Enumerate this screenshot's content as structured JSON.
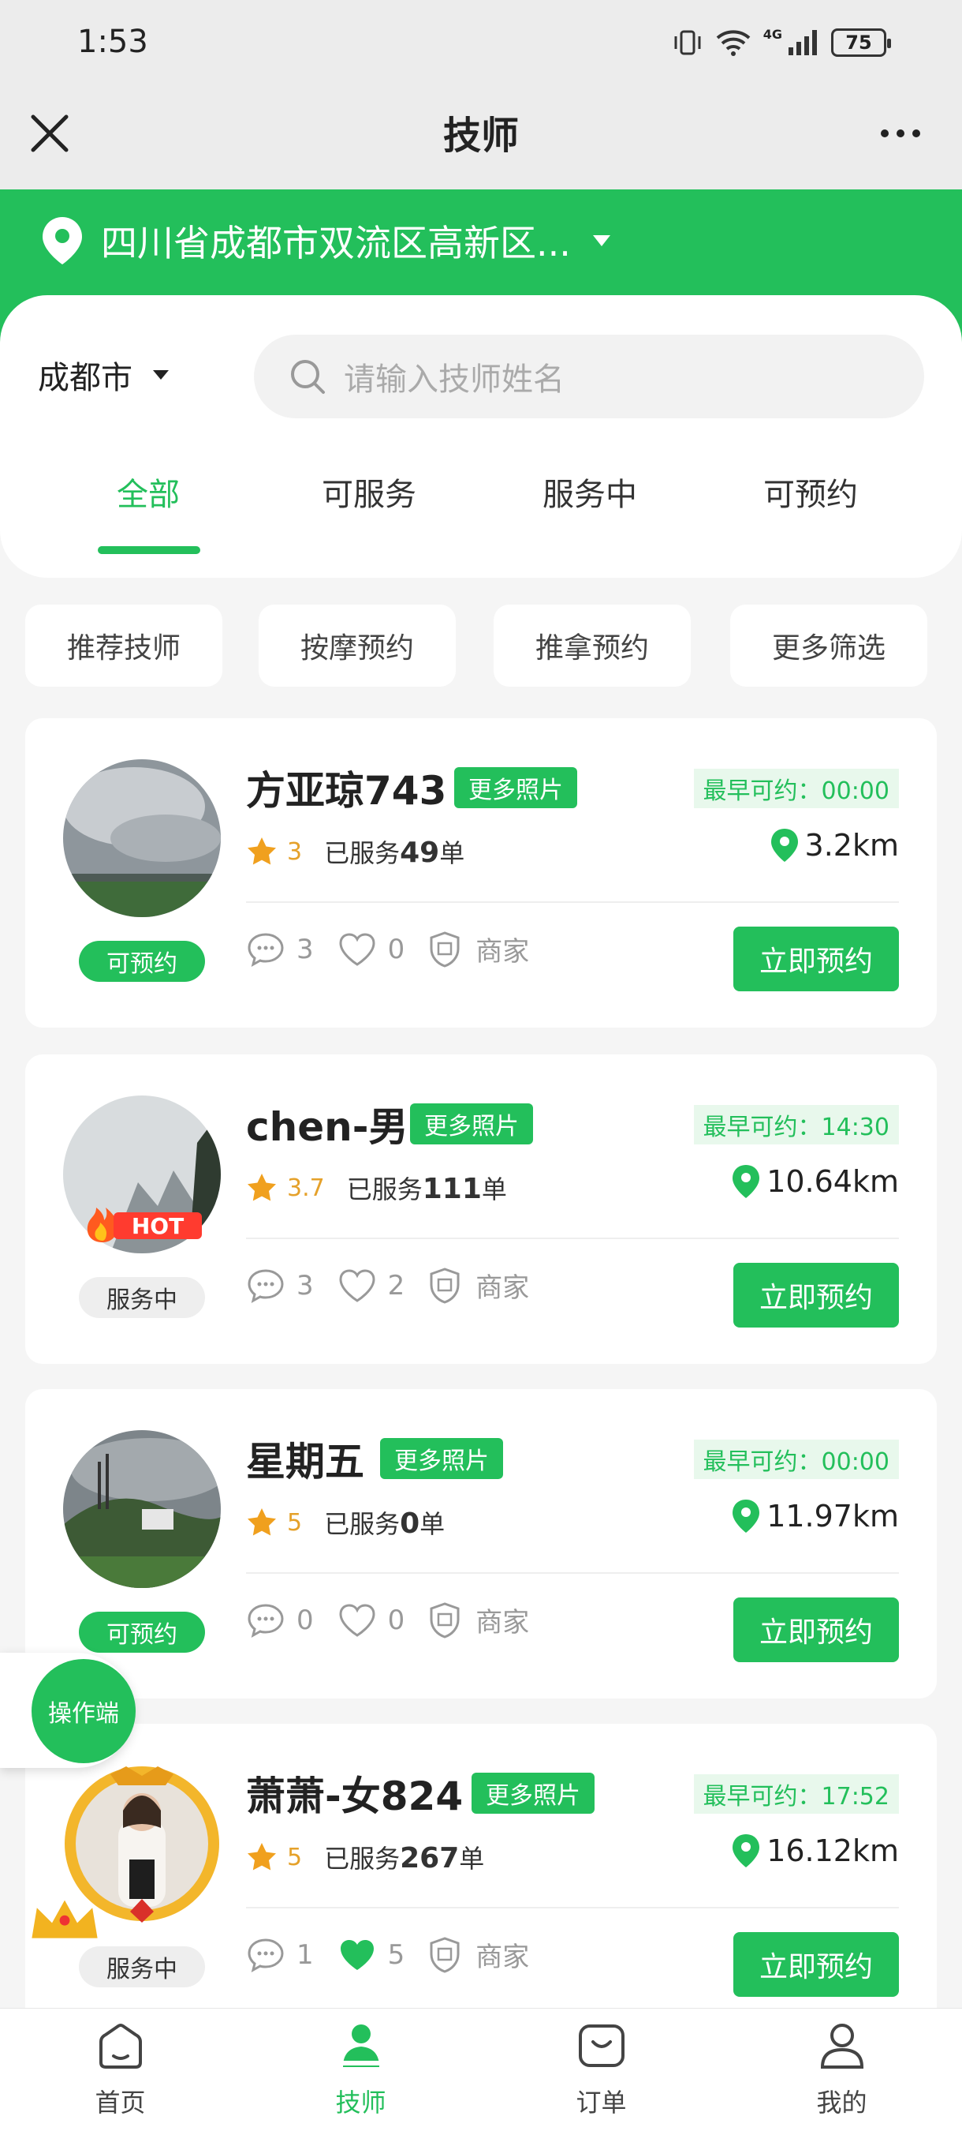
{
  "status_bar": {
    "time": "1:53",
    "battery": "75",
    "network": "4G"
  },
  "header": {
    "title": "技师"
  },
  "location": {
    "text": "四川省成都市双流区高新区..."
  },
  "city": "成都市",
  "search": {
    "placeholder": "请输入技师姓名"
  },
  "tabs": [
    "全部",
    "可服务",
    "服务中",
    "可预约"
  ],
  "filters": [
    "推荐技师",
    "按摩预约",
    "推拿预约",
    "更多筛选"
  ],
  "technicians": [
    {
      "name": "方亚琼743",
      "more_photos": "更多照片",
      "earliest": "最早可约：00:00",
      "rating": "3",
      "served_prefix": "已服务",
      "served_count": "49",
      "served_suffix": "单",
      "distance": "3.2km",
      "comments": "3",
      "likes": "0",
      "shop_label": "商家",
      "status": "可预约",
      "book": "立即预约",
      "hot": false
    },
    {
      "name": "chen-男",
      "more_photos": "更多照片",
      "earliest": "最早可约：14:30",
      "rating": "3.7",
      "served_prefix": "已服务",
      "served_count": "111",
      "served_suffix": "单",
      "distance": "10.64km",
      "comments": "3",
      "likes": "2",
      "shop_label": "商家",
      "status": "服务中",
      "book": "立即预约",
      "hot": true
    },
    {
      "name": "星期五",
      "more_photos": "更多照片",
      "earliest": "最早可约：00:00",
      "rating": "5",
      "served_prefix": "已服务",
      "served_count": "0",
      "served_suffix": "单",
      "distance": "11.97km",
      "comments": "0",
      "likes": "0",
      "shop_label": "商家",
      "status": "可预约",
      "book": "立即预约",
      "hot": false
    },
    {
      "name": "萧萧-女824",
      "more_photos": "更多照片",
      "earliest": "最早可约：17:52",
      "rating": "5",
      "served_prefix": "已服务",
      "served_count": "267",
      "served_suffix": "单",
      "distance": "16.12km",
      "comments": "1",
      "likes": "5",
      "shop_label": "商家",
      "status": "服务中",
      "book": "立即预约",
      "hot": false
    }
  ],
  "float_button": "操作端",
  "tabbar": [
    "首页",
    "技师",
    "订单",
    "我的"
  ],
  "colors": {
    "primary": "#23bf5b",
    "rating": "#e5a12a"
  }
}
